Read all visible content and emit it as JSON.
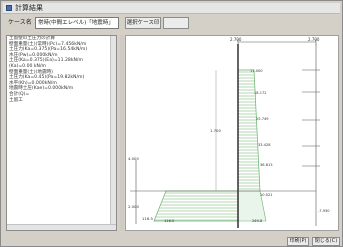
{
  "window": {
    "title": "計算結果"
  },
  "toolbar": {
    "label": "ケース名",
    "select_value": "常時(中間エレベル)「地震時」",
    "btn_case": "選択ケース印",
    "btn_blank": ""
  },
  "left_list": [
    "土留壁の土圧力の計算",
    "壁面重量(土)(常時)(Pc)=7.456kN/m",
    "土圧力(Ka=0.375)(Pa=16.54kN/m)",
    "水圧(Pw)=0.000kN/m",
    "土圧(Ka=0.375)(Ea)=11.28kN/m",
    "(Ka)=0.00 kN/m",
    "壁面重量(土)(地震時)",
    "土圧力(Ka=0.45)(Pa=19.82kN/m)",
    "水平(Kh)=0.000kN/m",
    "地震時土圧(Kae)=0.000kN/m",
    "合計(Q)=",
    "土留工"
  ],
  "drawing": {
    "top_labels": [
      "2.700",
      "2.700"
    ],
    "right_values": [
      "11.000",
      "18.172",
      "25.749",
      "33.428",
      "36.813",
      "10.021"
    ],
    "left_values": [
      "4.000",
      "2.000",
      "1.700",
      "116.5"
    ],
    "bottom_values": [
      "116.5",
      "269.8"
    ],
    "depth_label": "-7.930"
  },
  "bottom": {
    "btn_print": "印刷(P)",
    "btn_close": "閉じる(C)"
  },
  "colors": {
    "hatch": "#6ab06e",
    "frame": "#8a8a8a",
    "line": "#333333"
  }
}
